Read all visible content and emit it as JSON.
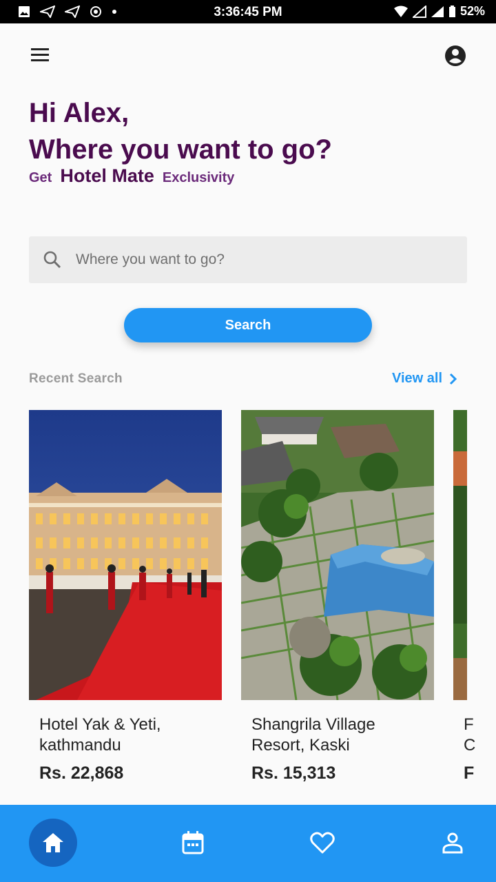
{
  "status_bar": {
    "time": "3:36:45 PM",
    "battery": "52%"
  },
  "greeting": {
    "line1": "Hi Alex,",
    "line2": "Where you want to go?"
  },
  "tagline": {
    "prefix": "Get",
    "brand": "Hotel Mate",
    "suffix": "Exclusivity"
  },
  "search": {
    "placeholder": "Where you want to go?",
    "value": "",
    "button_label": "Search"
  },
  "recent": {
    "title": "Recent Search",
    "view_all": "View all",
    "items": [
      {
        "name": "Hotel Yak & Yeti, kathmandu",
        "price": "Rs. 22,868"
      },
      {
        "name": "Shangrila Village Resort, Kaski",
        "price": "Rs. 15,313"
      },
      {
        "name": "F\nC",
        "price": "F"
      }
    ]
  },
  "bottom_nav": {
    "items": [
      {
        "icon": "home-icon",
        "active": true
      },
      {
        "icon": "calendar-icon",
        "active": false
      },
      {
        "icon": "heart-icon",
        "active": false
      },
      {
        "icon": "person-icon",
        "active": false
      }
    ]
  },
  "colors": {
    "primary": "#2196f3",
    "heading": "#4a0b4e",
    "active_nav": "#1565c0"
  }
}
